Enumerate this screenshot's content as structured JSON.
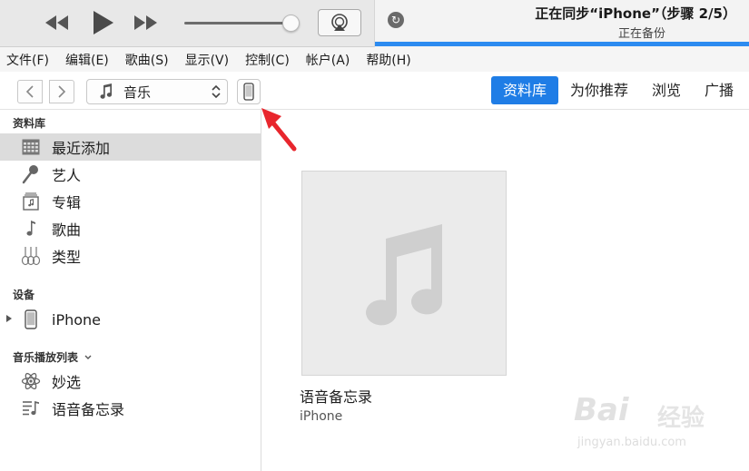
{
  "player": {
    "sync_title": "正在同步“iPhone”（步骤 2/5）",
    "sync_status": "正在备份",
    "sync_progress_percent": 100
  },
  "menu": [
    "文件(F)",
    "编辑(E)",
    "歌曲(S)",
    "显示(V)",
    "控制(C)",
    "帐户(A)",
    "帮助(H)"
  ],
  "toolbar": {
    "media_kind": "音乐",
    "tabs": [
      {
        "label": "资料库",
        "active": true
      },
      {
        "label": "为你推荐",
        "active": false
      },
      {
        "label": "浏览",
        "active": false
      },
      {
        "label": "广播",
        "active": false
      }
    ]
  },
  "sidebar": {
    "library_header": "资料库",
    "library_items": [
      {
        "label": "最近添加",
        "icon": "grid-calendar-icon",
        "selected": true
      },
      {
        "label": "艺人",
        "icon": "microphone-icon",
        "selected": false
      },
      {
        "label": "专辑",
        "icon": "album-icon",
        "selected": false
      },
      {
        "label": "歌曲",
        "icon": "music-note-icon",
        "selected": false
      },
      {
        "label": "类型",
        "icon": "guitars-icon",
        "selected": false
      }
    ],
    "devices_header": "设备",
    "device": {
      "label": "iPhone",
      "icon": "iphone-icon"
    },
    "playlists_header": "音乐播放列表",
    "playlists": [
      {
        "label": "妙选",
        "icon": "atom-icon"
      },
      {
        "label": "语音备忘录",
        "icon": "playlist-icon"
      }
    ]
  },
  "main": {
    "album": {
      "title": "语音备忘录",
      "subtitle": "iPhone"
    }
  },
  "watermark": {
    "brand": "Bai",
    "brand_cn": "经验",
    "url": "jingyan.baidu.com"
  },
  "colors": {
    "accent": "#1f7de6",
    "sync_bar": "#2c8bf0",
    "arrow": "#e8262d"
  }
}
